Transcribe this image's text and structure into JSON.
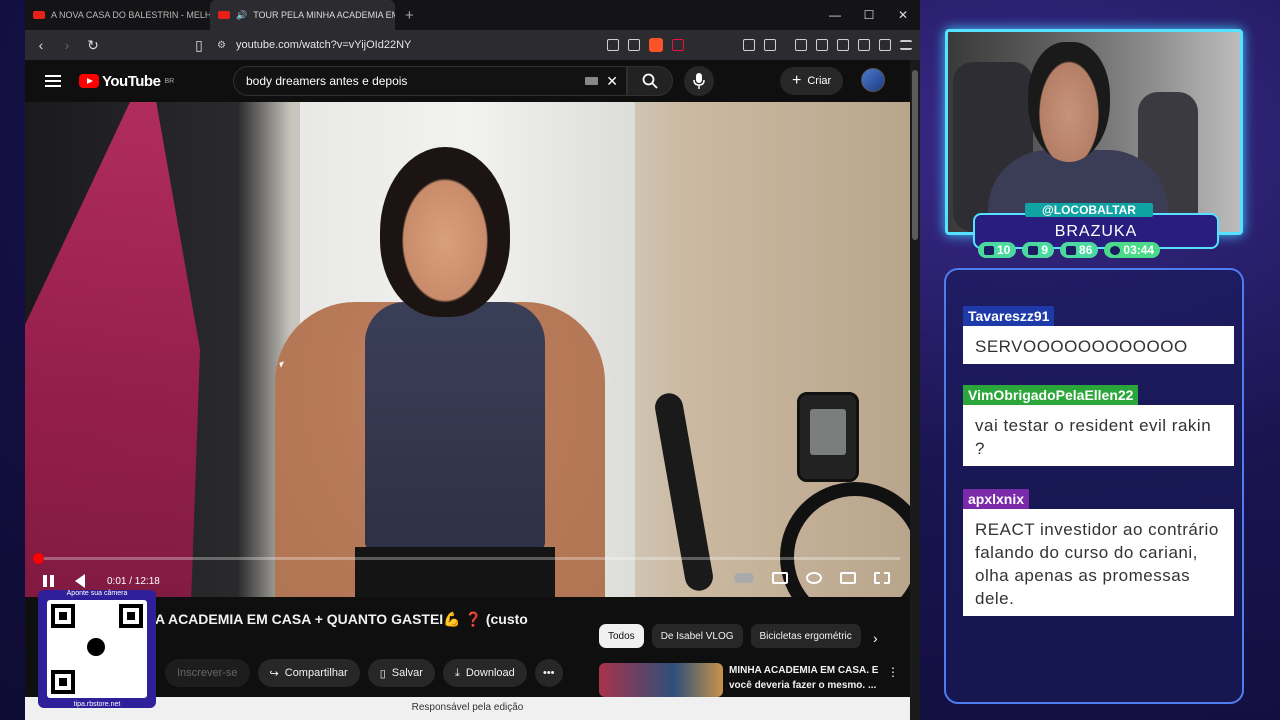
{
  "browser": {
    "tabs": [
      {
        "label": "A NOVA CASA DO BALESTRIN - MELHOR DO",
        "active": false
      },
      {
        "label": "TOUR PELA MINHA ACADEMIA EM",
        "active": true
      }
    ],
    "new_tab": "+",
    "url": "youtube.com/watch?v=vYijOId22NY",
    "window_controls": [
      "—",
      "☐",
      "✕"
    ]
  },
  "youtube": {
    "logo_word": "YouTube",
    "logo_region": "BR",
    "search_value": "body dreamers antes e depois",
    "create_label": "Criar",
    "player": {
      "time": "0:01 / 12:18",
      "progress": 0.0014
    },
    "video_title": "A ACADEMIA EM CASA + QUANTO GASTEI💪 ❓ (custo",
    "chips": [
      "Todos",
      "De Isabel VLOG",
      "Bicicletas ergométric"
    ],
    "actions": {
      "subscribe": "Inscrever-se",
      "share": "Compartilhar",
      "save": "Salvar",
      "download": "Download"
    },
    "recommendation_title": "MINHA ACADEMIA EM CASA. E você deveria fazer o mesmo. ...",
    "edit_bar": "Responsável pela edição"
  },
  "qr": {
    "top_label": "Aponte sua câmera",
    "bottom_label": "tipa.rbstore.net"
  },
  "stream": {
    "handle": "@LOCOBALTAR",
    "name": "BRAZUKA",
    "stats": [
      {
        "icon": "twitch-icon",
        "value": "10"
      },
      {
        "icon": "youtube-icon",
        "value": "9"
      },
      {
        "icon": "kick-icon",
        "value": "86"
      },
      {
        "icon": "clock-icon",
        "value": "03:44"
      }
    ]
  },
  "chat": {
    "messages": [
      {
        "user": "Tavareszz91",
        "color": "#1e3aa8",
        "text": "SERVOOOOOOOOOOOO"
      },
      {
        "user": "VimObrigadoPelaEllen22",
        "color": "#2aa63a",
        "text": "vai testar o resident evil rakin ?"
      },
      {
        "user": "apxlxnix",
        "color": "#7a2aa8",
        "text": "REACT investidor ao contrário falando do curso do cariani, olha apenas as promessas dele."
      }
    ]
  }
}
